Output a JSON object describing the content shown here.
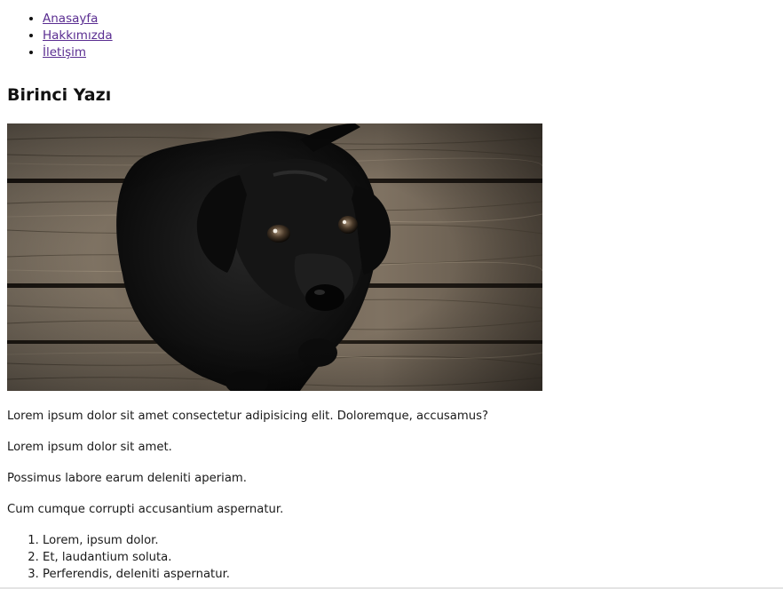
{
  "nav": {
    "items": [
      {
        "label": "Anasayfa"
      },
      {
        "label": "Hakkımızda"
      },
      {
        "label": "İletişim"
      }
    ]
  },
  "post": {
    "title": "Birinci Yazı",
    "paragraphs": [
      "Lorem ipsum dolor sit amet consectetur adipisicing elit. Doloremque, accusamus?",
      "Lorem ipsum dolor sit amet.",
      "Possimus labore earum deleniti aperiam.",
      "Cum cumque corrupti accusantium aspernatur."
    ],
    "list": [
      "Lorem, ipsum dolor.",
      "Et, laudantium soluta.",
      "Perferendis, deleniti aspernatur."
    ]
  },
  "colors": {
    "link": "#5a2d91",
    "text": "#111111"
  }
}
